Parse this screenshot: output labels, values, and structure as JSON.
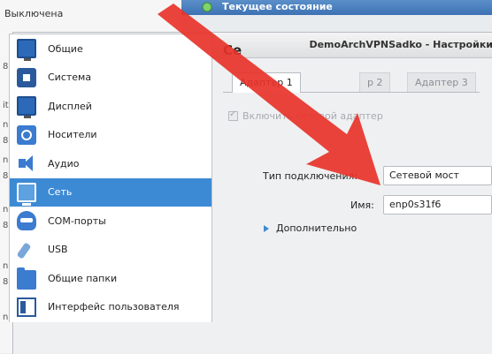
{
  "background": {
    "status_text": "Выключена",
    "header_text": "Текущее состояние",
    "left_strip_letters": [
      "8",
      "it",
      "n",
      "8",
      "n",
      "8",
      "n",
      "8",
      "n",
      "8",
      "n"
    ]
  },
  "dialog": {
    "title": "DemoArchVPNSadko - Настройки"
  },
  "sidebar": {
    "items": [
      {
        "label": "Общие",
        "icon": "general-icon"
      },
      {
        "label": "Система",
        "icon": "system-icon"
      },
      {
        "label": "Дисплей",
        "icon": "display-icon"
      },
      {
        "label": "Носители",
        "icon": "storage-icon"
      },
      {
        "label": "Аудио",
        "icon": "audio-icon"
      },
      {
        "label": "Сеть",
        "icon": "network-icon",
        "selected": true
      },
      {
        "label": "COM-порты",
        "icon": "serial-ports-icon"
      },
      {
        "label": "USB",
        "icon": "usb-icon"
      },
      {
        "label": "Общие папки",
        "icon": "shared-folders-icon"
      },
      {
        "label": "Интерфейс пользователя",
        "icon": "user-interface-icon"
      }
    ]
  },
  "content": {
    "page_title": "Се",
    "tabs": [
      {
        "label": "Адаптер 1",
        "active": true
      },
      {
        "label": "р 2",
        "active": false
      },
      {
        "label": "Адаптер 3",
        "active": false
      }
    ],
    "enable_adapter_label": "Включить сетевой адаптер",
    "connection_type_label": "Тип подключения:",
    "connection_type_value": "Сетевой мост",
    "name_label": "Имя:",
    "name_value": "enp0s31f6",
    "advanced_label": "Дополнительно"
  },
  "colors": {
    "selection": "#3d8ad4",
    "arrow": "#e8332a"
  }
}
